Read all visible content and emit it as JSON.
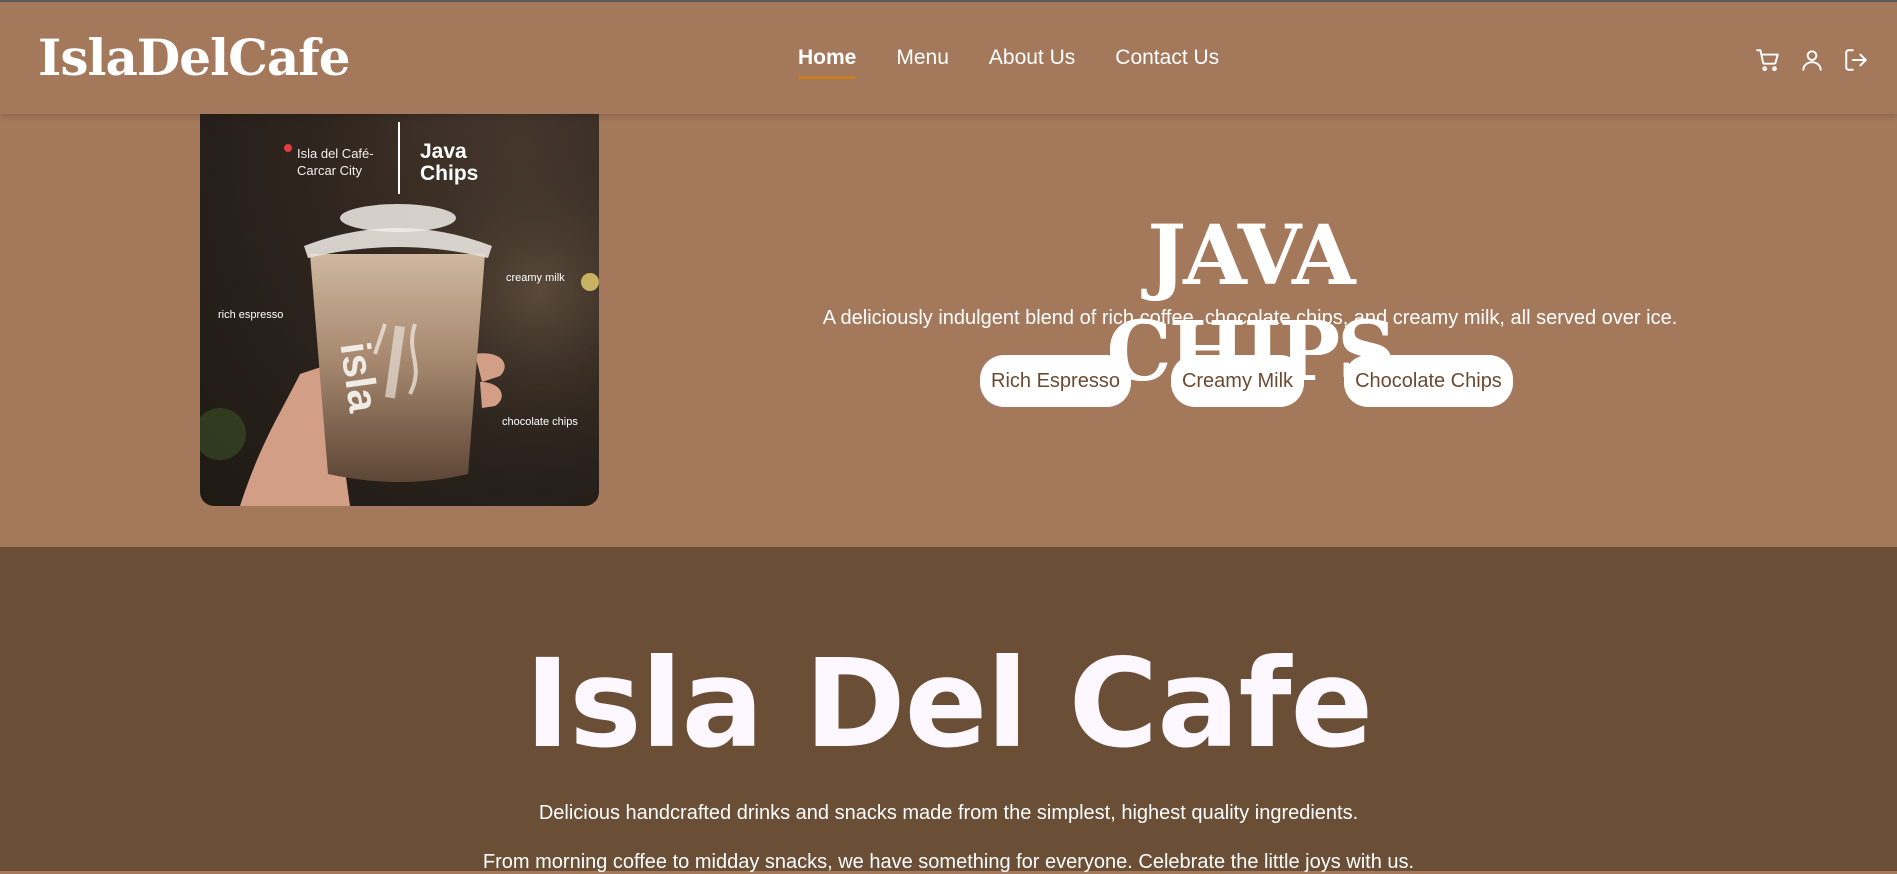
{
  "brand": {
    "logo": "IslaDelCafe"
  },
  "nav": {
    "items": [
      {
        "label": "Home",
        "active": true
      },
      {
        "label": "Menu"
      },
      {
        "label": "About Us"
      },
      {
        "label": "Contact Us"
      }
    ]
  },
  "header_icons": [
    "cart-icon",
    "user-icon",
    "logout-icon"
  ],
  "hero": {
    "image": {
      "location": "Isla del Café-",
      "location2": "Carcar City",
      "title_line1": "Java",
      "title_line2": "Chips",
      "labels": [
        "rich espresso",
        "creamy milk",
        "chocolate chips"
      ],
      "cup_brand": "isla"
    },
    "title": "JAVA CHIPS",
    "description": "A deliciously indulgent blend of rich coffee, chocolate chips, and creamy milk, all served over ice.",
    "chips": [
      "Rich Espresso",
      "Creamy Milk",
      "Chocolate Chips"
    ]
  },
  "about": {
    "title": "Isla Del Cafe",
    "line1": "Delicious handcrafted drinks and snacks made from the simplest, highest quality ingredients.",
    "line2": "From morning coffee to midday snacks, we have something for everyone. Celebrate the little joys with us."
  },
  "colors": {
    "header_bg": "#a4785b",
    "about_bg": "#6b4e36",
    "accent": "#c47f27",
    "chip_text": "#6b4a32"
  }
}
